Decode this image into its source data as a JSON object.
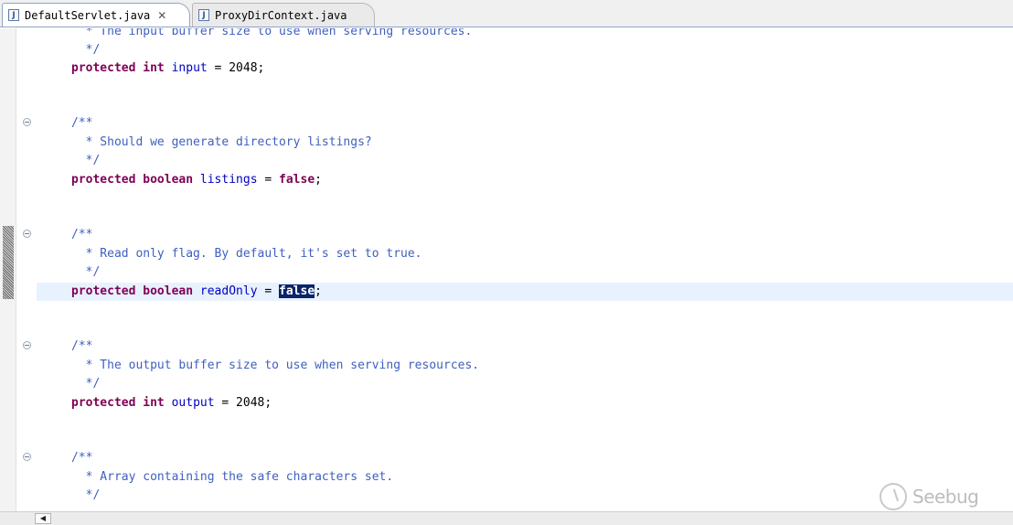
{
  "tabs": [
    {
      "label": "DefaultServlet.java",
      "icon": "java-file-icon",
      "active": true,
      "close_glyph": "✕"
    },
    {
      "label": "ProxyDirContext.java",
      "icon": "java-file-icon",
      "active": false
    }
  ],
  "code": {
    "l1": {
      "text": "  * The input buffer size to use when serving resources."
    },
    "l2": {
      "text": "  */"
    },
    "l3": {
      "kw1": "protected",
      "kw2": "int",
      "name": "input",
      "rest": " = 2048;"
    },
    "l4": {
      "text": "/**"
    },
    "l5": {
      "text": "  * Should we generate directory listings?"
    },
    "l6": {
      "text": "  */"
    },
    "l7": {
      "kw1": "protected",
      "kw2": "boolean",
      "name": "listings",
      "eq": " = ",
      "val": "false",
      "end": ";"
    },
    "l8": {
      "text": "/**"
    },
    "l9": {
      "text": "  * Read only flag. By default, it's set to true."
    },
    "l10": {
      "text": "  */"
    },
    "l11": {
      "kw1": "protected",
      "kw2": "boolean",
      "name": "readOnly",
      "eq": " = ",
      "val": "false",
      "end": ";"
    },
    "l12": {
      "text": "/**"
    },
    "l13": {
      "text": "  * The output buffer size to use when serving resources."
    },
    "l14": {
      "text": "  */"
    },
    "l15": {
      "kw1": "protected",
      "kw2": "int",
      "name": "output",
      "rest": " = 2048;"
    },
    "l16": {
      "text": "/**"
    },
    "l17": {
      "text": "  * Array containing the safe characters set."
    },
    "l18": {
      "text": "  */"
    }
  },
  "watermark": {
    "text": "Seebug"
  },
  "colors": {
    "keyword": "#7f0055",
    "comment": "#3f5fbf",
    "field": "#0000c0",
    "selection": "#0a246a",
    "current_line": "#e8f2fe"
  }
}
